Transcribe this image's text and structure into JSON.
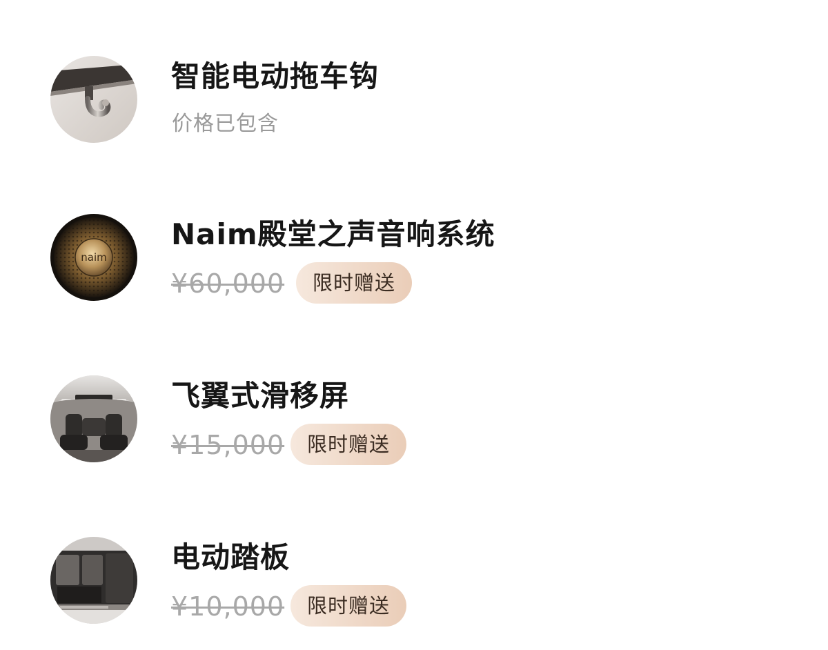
{
  "items": [
    {
      "icon": "tow-hook-image",
      "title": "智能电动拖车钩",
      "subtitle": "价格已包含"
    },
    {
      "icon": "naim-speaker-image",
      "title": "Naim殿堂之声音响系统",
      "price": "¥60,000",
      "badge": "限时赠送"
    },
    {
      "icon": "sliding-screen-image",
      "title": "飞翼式滑移屏",
      "price": "¥15,000",
      "badge": "限时赠送"
    },
    {
      "icon": "power-step-image",
      "title": "电动踏板",
      "price": "¥10,000",
      "badge": "限时赠送"
    }
  ],
  "colors": {
    "title": "#161616",
    "muted": "#9a9a9a",
    "strikethrough_price": "#a8a8a8",
    "badge_gradient_start": "#f6e8dd",
    "badge_gradient_end": "#eacdb8",
    "badge_text": "#3b2c22"
  }
}
